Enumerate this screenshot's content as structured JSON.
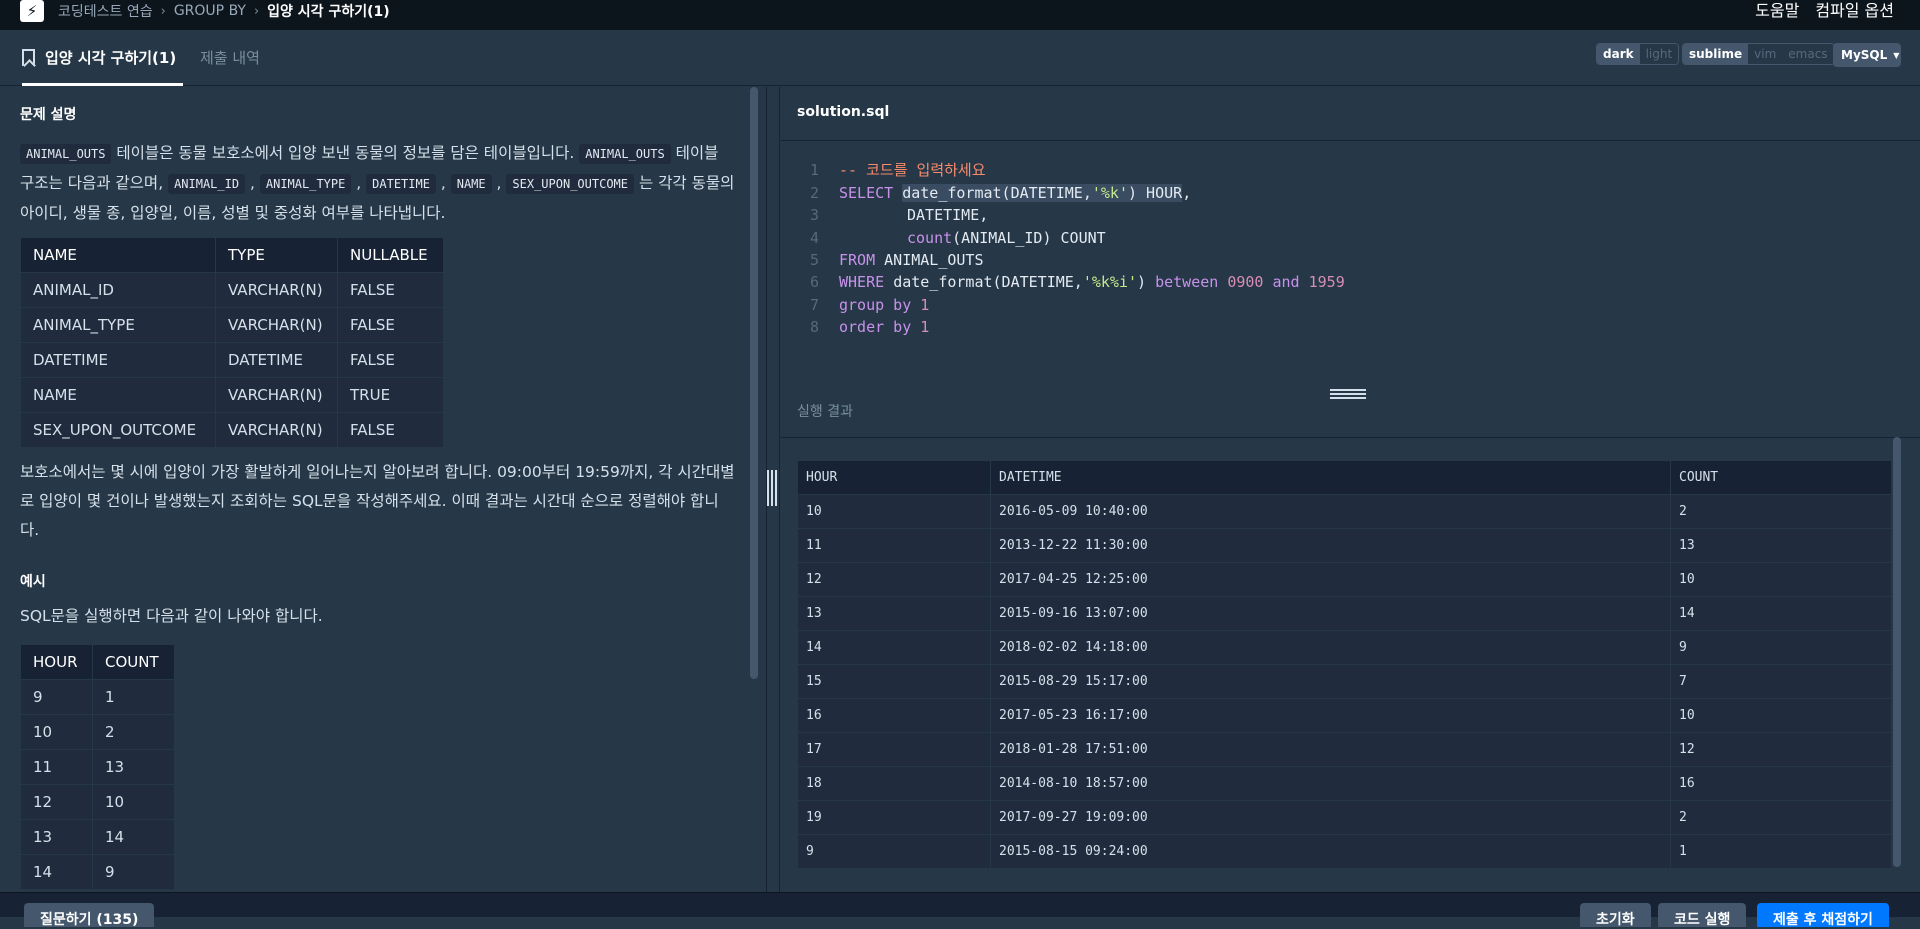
{
  "breadcrumb": [
    "코딩테스트 연습",
    "GROUP BY",
    "입양 시각 구하기(1)"
  ],
  "top_links": [
    "도움말",
    "컴파일 옵션"
  ],
  "tabs": {
    "active": "입양 시각 구하기(1)",
    "inactive": "제출 내역"
  },
  "theme_toggle": [
    "dark",
    "light"
  ],
  "editor_toggle": [
    "sublime",
    "vim",
    "emacs"
  ],
  "language": "MySQL",
  "problem": {
    "heading": "문제 설명",
    "intro": {
      "t_animal_outs1": "ANIMAL_OUTS",
      "t1": " 테이블은 동물 보호소에서 입양 보낸 동물의 정보를 담은 테이블입니다. ",
      "t_animal_outs2": "ANIMAL_OUTS",
      "t2": " 테이블 구조는 다음과 같으며, ",
      "c1": "ANIMAL_ID",
      "c2": "ANIMAL_TYPE",
      "c3": "DATETIME",
      "c4": "NAME",
      "c5": "SEX_UPON_OUTCOME",
      "t3": "는 각각 동물의 아이디, 생물 종, 입양일, 이름, 성별 및 중성화 여부를 나타냅니다."
    },
    "schema_headers": [
      "NAME",
      "TYPE",
      "NULLABLE"
    ],
    "schema_rows": [
      [
        "ANIMAL_ID",
        "VARCHAR(N)",
        "FALSE"
      ],
      [
        "ANIMAL_TYPE",
        "VARCHAR(N)",
        "FALSE"
      ],
      [
        "DATETIME",
        "DATETIME",
        "FALSE"
      ],
      [
        "NAME",
        "VARCHAR(N)",
        "TRUE"
      ],
      [
        "SEX_UPON_OUTCOME",
        "VARCHAR(N)",
        "FALSE"
      ]
    ],
    "task": "보호소에서는 몇 시에 입양이 가장 활발하게 일어나는지 알아보려 합니다. 09:00부터 19:59까지, 각 시간대별로 입양이 몇 건이나 발생했는지 조회하는 SQL문을 작성해주세요. 이때 결과는 시간대 순으로 정렬해야 합니다.",
    "example_heading": "예시",
    "example_text": "SQL문을 실행하면 다음과 같이 나와야 합니다.",
    "example_headers": [
      "HOUR",
      "COUNT"
    ],
    "example_rows": [
      [
        "9",
        "1"
      ],
      [
        "10",
        "2"
      ],
      [
        "11",
        "13"
      ],
      [
        "12",
        "10"
      ],
      [
        "13",
        "14"
      ],
      [
        "14",
        "9"
      ]
    ]
  },
  "editor": {
    "filename": "solution.sql",
    "line_numbers": [
      "1",
      "2",
      "3",
      "4",
      "5",
      "6",
      "7",
      "8"
    ],
    "code": {
      "l1": "-- 코드를 입력하세요",
      "l2_kw": "SELECT ",
      "l2_a": "date_format(DATETIME,",
      "l2_s": "'%k'",
      "l2_b": ") HOUR",
      "l2_c": ",",
      "l3": "DATETIME,",
      "l4_kw": "count",
      "l4_a": "(ANIMAL_ID) COUNT",
      "l5_kw": "FROM ",
      "l5_a": "ANIMAL_OUTS",
      "l6_kw": "WHERE ",
      "l6_a": "date_format(DATETIME,",
      "l6_s": "'%k%i'",
      "l6_b": ") ",
      "l6_kw2": "between ",
      "l6_n1": "0900",
      "l6_kw3": " and ",
      "l6_n2": "1959",
      "l7_kw": "group by ",
      "l7_n": "1",
      "l8_kw": "order by ",
      "l8_n": "1"
    }
  },
  "result": {
    "label": "실행 결과",
    "headers": [
      "HOUR",
      "DATETIME",
      "COUNT"
    ],
    "rows": [
      [
        "10",
        "2016-05-09 10:40:00",
        "2"
      ],
      [
        "11",
        "2013-12-22 11:30:00",
        "13"
      ],
      [
        "12",
        "2017-04-25 12:25:00",
        "10"
      ],
      [
        "13",
        "2015-09-16 13:07:00",
        "14"
      ],
      [
        "14",
        "2018-02-02 14:18:00",
        "9"
      ],
      [
        "15",
        "2015-08-29 15:17:00",
        "7"
      ],
      [
        "16",
        "2017-05-23 16:17:00",
        "10"
      ],
      [
        "17",
        "2018-01-28 17:51:00",
        "12"
      ],
      [
        "18",
        "2014-08-10 18:57:00",
        "16"
      ],
      [
        "19",
        "2017-09-27 19:09:00",
        "2"
      ],
      [
        "9",
        "2015-08-15 09:24:00",
        "1"
      ]
    ]
  },
  "footer": {
    "question_button": "질문하기 (135)",
    "reset_button": "초기화",
    "run_button": "코드 실행",
    "submit_button": "제출 후 채점하기"
  }
}
